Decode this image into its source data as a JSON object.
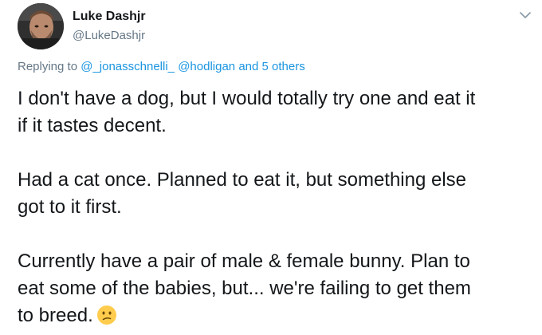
{
  "author": {
    "name": "Luke Dashjr",
    "handle": "@LukeDashjr"
  },
  "menu_icon": "chevron-down-icon",
  "reply": {
    "prefix": "Replying to",
    "mention_1": "@_jonasschnelli_",
    "mention_2": "@hodligan",
    "and_others": "and 5 others"
  },
  "body": {
    "p1_line1": "I don't have a dog, but I would totally try one and eat it",
    "p1_line2": "if it tastes decent.",
    "p2_line1": "Had a cat once. Planned to eat it, but something else",
    "p2_line2": "got to it first.",
    "p3_line1": "Currently have a pair of male & female bunny. Plan to",
    "p3_line2": "eat some of the babies, but... we're failing to get them",
    "p3_line3": "to breed.",
    "emoji": "confused-face-icon"
  },
  "colors": {
    "text": "#14171a",
    "secondary": "#657786",
    "link": "#1b95e0"
  }
}
